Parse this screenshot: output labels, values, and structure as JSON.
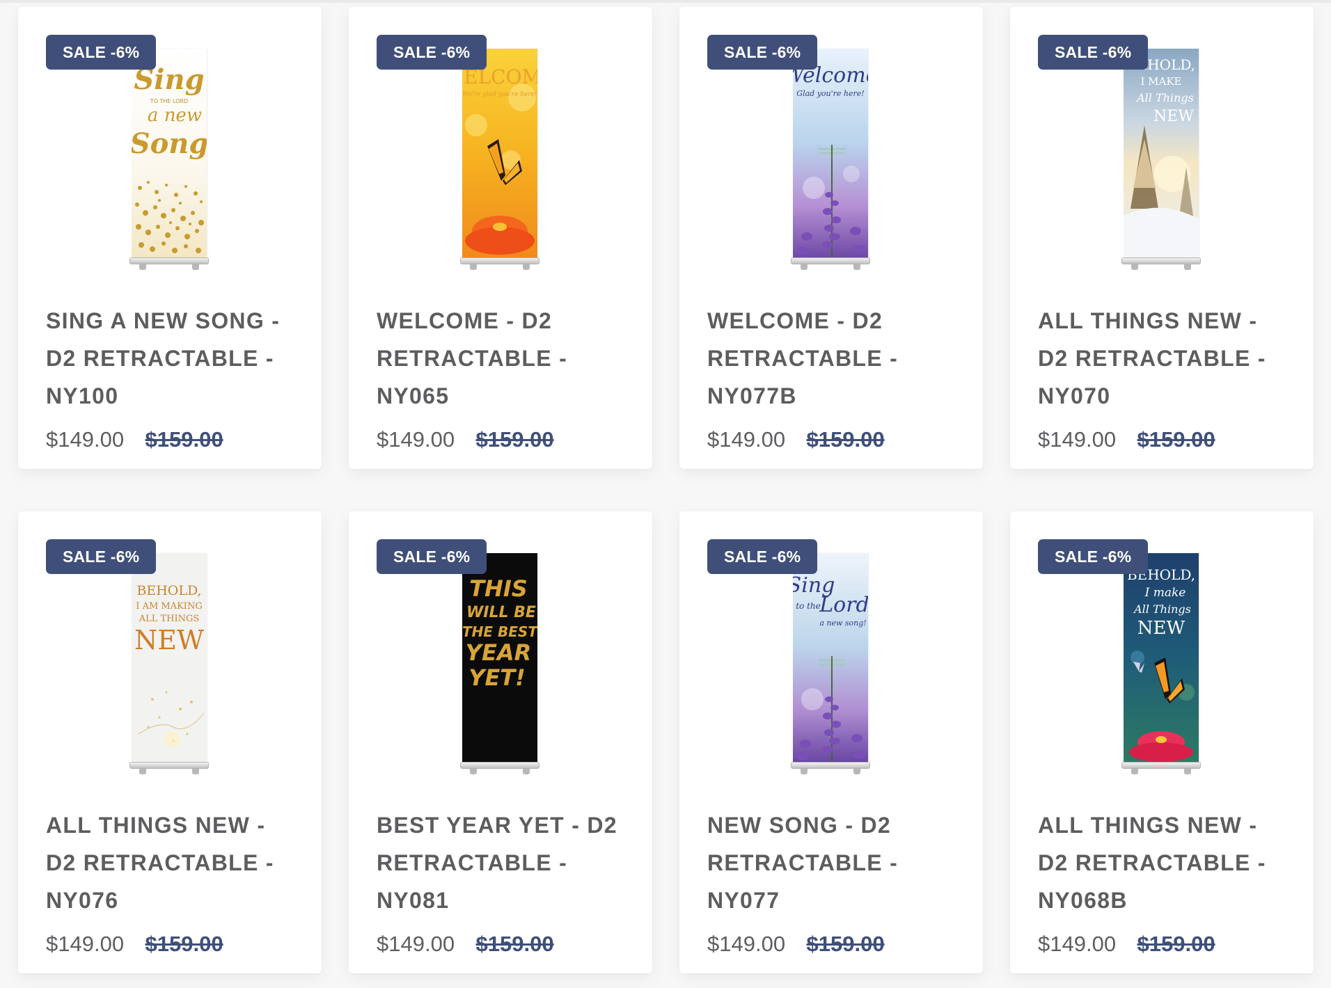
{
  "badge_label": "SALE -6%",
  "colors": {
    "badge_bg": "#3f4f79",
    "old_price": "#3f4f79",
    "title_text": "#5d5d60",
    "price_text": "#5e5e62"
  },
  "products": [
    {
      "title": "SING A NEW SONG - D2 RETRACTABLE - NY100",
      "price": "$149.00",
      "compare_price": "$159.00",
      "banner_text": [
        "Sing",
        "TO THE LORD",
        "a new",
        "Song"
      ]
    },
    {
      "title": "WELCOME - D2 RETRACTABLE - NY065",
      "price": "$149.00",
      "compare_price": "$159.00",
      "banner_text": [
        "WELCOME",
        "We're glad you're here!"
      ]
    },
    {
      "title": "WELCOME - D2 RETRACTABLE - NY077B",
      "price": "$149.00",
      "compare_price": "$159.00",
      "banner_text": [
        "Welcome",
        "Glad you're here!"
      ]
    },
    {
      "title": "ALL THINGS NEW - D2 RETRACTABLE - NY070",
      "price": "$149.00",
      "compare_price": "$159.00",
      "banner_text": [
        "BEHOLD,",
        "I MAKE",
        "All Things",
        "NEW"
      ]
    },
    {
      "title": "ALL THINGS NEW - D2 RETRACTABLE - NY076",
      "price": "$149.00",
      "compare_price": "$159.00",
      "banner_text": [
        "BEHOLD,",
        "I AM MAKING",
        "ALL THINGS",
        "NEW"
      ]
    },
    {
      "title": "BEST YEAR YET - D2 RETRACTABLE - NY081",
      "price": "$149.00",
      "compare_price": "$159.00",
      "banner_text": [
        "THIS",
        "WILL BE",
        "THE BEST",
        "YEAR",
        "YET!"
      ]
    },
    {
      "title": "NEW SONG - D2 RETRACTABLE - NY077",
      "price": "$149.00",
      "compare_price": "$159.00",
      "banner_text": [
        "Sing",
        "to the",
        "Lord",
        "a new song!"
      ]
    },
    {
      "title": "ALL THINGS NEW - D2 RETRACTABLE - NY068B",
      "price": "$149.00",
      "compare_price": "$159.00",
      "banner_text": [
        "BEHOLD,",
        "I make",
        "All Things",
        "NEW"
      ]
    }
  ]
}
